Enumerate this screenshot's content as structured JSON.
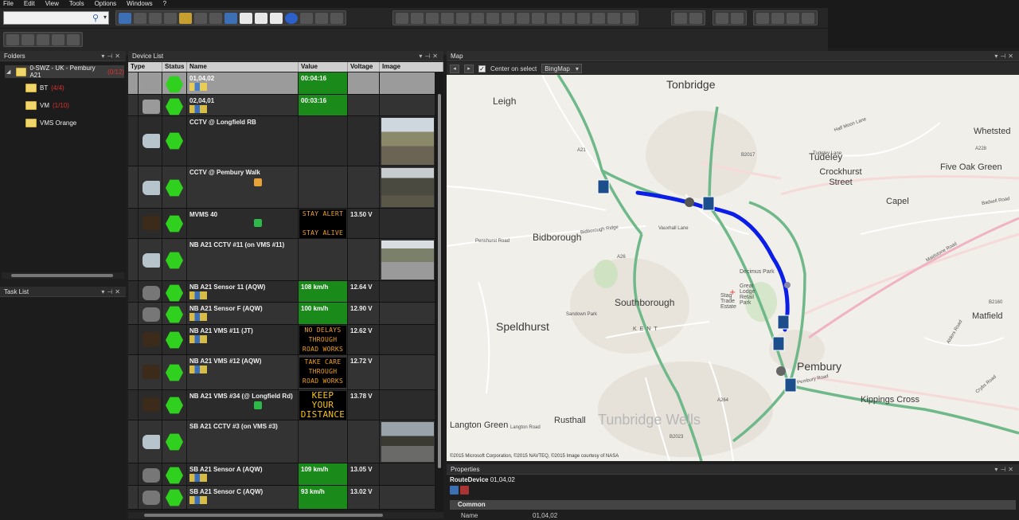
{
  "menu": [
    "File",
    "Edit",
    "View",
    "Tools",
    "Options",
    "Windows",
    "?"
  ],
  "search": {
    "value": ""
  },
  "folders_panel": {
    "title": "Folders",
    "root": {
      "label": "0-SWZ - UK - Pembury A21",
      "count": "(0/12)"
    },
    "items": [
      {
        "label": "BT",
        "count": "(4/4)"
      },
      {
        "label": "VM",
        "count": "(1/10)"
      },
      {
        "label": "VMS Orange",
        "count": ""
      }
    ]
  },
  "tasks_panel": {
    "title": "Task List"
  },
  "device_list": {
    "title": "Device List",
    "columns": [
      "Type",
      "Status",
      "Name",
      "Value",
      "Voltage",
      "Image"
    ],
    "rows": [
      {
        "name": "01,04,02",
        "value": "00:04:16",
        "voltage": "",
        "kind": "clock"
      },
      {
        "name": "02,04,01",
        "value": "00:03:16",
        "voltage": "",
        "kind": "clock"
      },
      {
        "name": "CCTV @ Longfield RB",
        "value": "",
        "voltage": "",
        "kind": "cam"
      },
      {
        "name": "CCTV @ Pembury Walk",
        "value": "",
        "voltage": "",
        "kind": "cam"
      },
      {
        "name": "MVMS 40",
        "vms": [
          "STAY ALERT",
          "",
          "STAY ALIVE"
        ],
        "voltage": "13.50 V",
        "kind": "vms"
      },
      {
        "name": "NB A21 CCTV #11 (on VMS #11)",
        "value": "",
        "voltage": "",
        "kind": "cam"
      },
      {
        "name": "NB A21 Sensor 11 (AQW)",
        "value": "108 km/h",
        "voltage": "12.64 V",
        "kind": "sensor"
      },
      {
        "name": "NB A21 Sensor F (AQW)",
        "value": "100 km/h",
        "voltage": "12.90 V",
        "kind": "sensor"
      },
      {
        "name": "NB A21 VMS #11 (JT)",
        "vms": [
          "NO DELAYS",
          "THROUGH",
          "ROAD WORKS"
        ],
        "voltage": "12.62 V",
        "kind": "vms"
      },
      {
        "name": "NB A21 VMS #12 (AQW)",
        "vms": [
          "TAKE CARE",
          "THROUGH",
          "ROAD WORKS"
        ],
        "voltage": "12.72 V",
        "kind": "vms"
      },
      {
        "name": "NB A21 VMS #34 (@ Longfield Rd)",
        "vms": [
          "KEEP",
          "YOUR",
          "DISTANCE"
        ],
        "voltage": "13.78 V",
        "kind": "vms"
      },
      {
        "name": "SB A21 CCTV #3 (on VMS #3)",
        "value": "",
        "voltage": "",
        "kind": "cam"
      },
      {
        "name": "SB A21 Sensor A (AQW)",
        "value": "109 km/h",
        "voltage": "13.05 V",
        "kind": "sensor"
      },
      {
        "name": "SB A21 Sensor C (AQW)",
        "value": "93 km/h",
        "voltage": "13.02 V",
        "kind": "sensor"
      }
    ]
  },
  "map_panel": {
    "title": "Map",
    "center_on_select_label": "Center on select",
    "provider": "BingMap",
    "copyright": "©2015 Microsoft Corporation, ©2015 NAVTEQ, ©2015 Image courtesy of NASA",
    "places": [
      "Tonbridge",
      "Leigh",
      "Tudeley",
      "Crockhurst Street",
      "Five Oak Green",
      "Whetsted",
      "Capel",
      "Bidborough",
      "Southborough",
      "Speldhurst",
      "Pembury",
      "Matfield",
      "Kippings Cross",
      "Tunbridge Wells",
      "Langton Green",
      "Rusthall",
      "Decimus Park",
      "Great Lodge Retail Park",
      "Stag Trade Estate",
      "KENT"
    ],
    "roads": [
      "A21",
      "A26",
      "A228",
      "A264",
      "B2017",
      "B2160",
      "B2023",
      "Pembury Road",
      "Vauxhall Lane",
      "Maidstone Road",
      "Penshurst Road",
      "Bidborough Ridge",
      "Langton Road",
      "Tudeley Lane",
      "Half Moon Lane",
      "Badsell Road",
      "Crybs Road",
      "Alders Road",
      "Sandown Park"
    ]
  },
  "properties_panel": {
    "title": "Properties",
    "object_type": "RouteDevice",
    "object_name": "01,04,02",
    "category": "Common",
    "rows": [
      {
        "key": "Name",
        "value": "01,04,02"
      }
    ]
  },
  "colors": {
    "status_ok": "#2fd11e",
    "value_bg": "#1a8a1a",
    "route": "#0a1ee8",
    "vms_text": "#f3a21a"
  }
}
